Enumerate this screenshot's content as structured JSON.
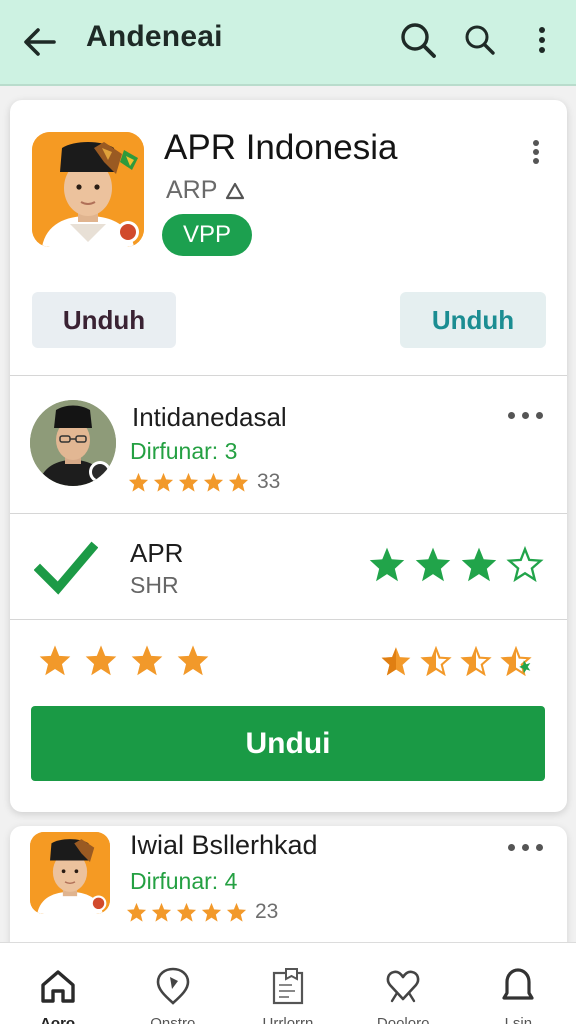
{
  "appbar": {
    "title": "Andeneai",
    "back_icon": "arrow-left-icon",
    "actions": [
      "search-icon",
      "search-icon",
      "more-vert-icon"
    ]
  },
  "app": {
    "title": "APR Indonesia",
    "subtitle": "ARP",
    "badge": "VPP",
    "button_left": "Unduh",
    "button_right": "Unduh"
  },
  "reviews": [
    {
      "name": "Intidanedasal",
      "meta": "Dirfunar: 3",
      "count": "33",
      "stars": 5
    },
    {
      "name": "Iwial Bsllerhkad",
      "meta": "Dirfunar: 4",
      "count": "23",
      "stars": 5
    }
  ],
  "status_row": {
    "title": "APR",
    "subtitle": "SHR",
    "rating_filled": 3,
    "rating_total": 4
  },
  "rating_row": {
    "left_stars": 4,
    "right_stars_half": 4
  },
  "cta": {
    "label": "Undui"
  },
  "bottom_nav": [
    {
      "label": "Aoro",
      "icon": "home-icon"
    },
    {
      "label": "Onstro",
      "icon": "location-pin-icon"
    },
    {
      "label": "Urrlorrn",
      "icon": "book-icon"
    },
    {
      "label": "Dooloro",
      "icon": "heart-icon"
    },
    {
      "label": "Lsin",
      "icon": "bell-icon"
    }
  ],
  "colors": {
    "appbar": "#cdf2e2",
    "green": "#1ca04f",
    "star_orange": "#f2992a",
    "star_green": "#21a44a"
  }
}
